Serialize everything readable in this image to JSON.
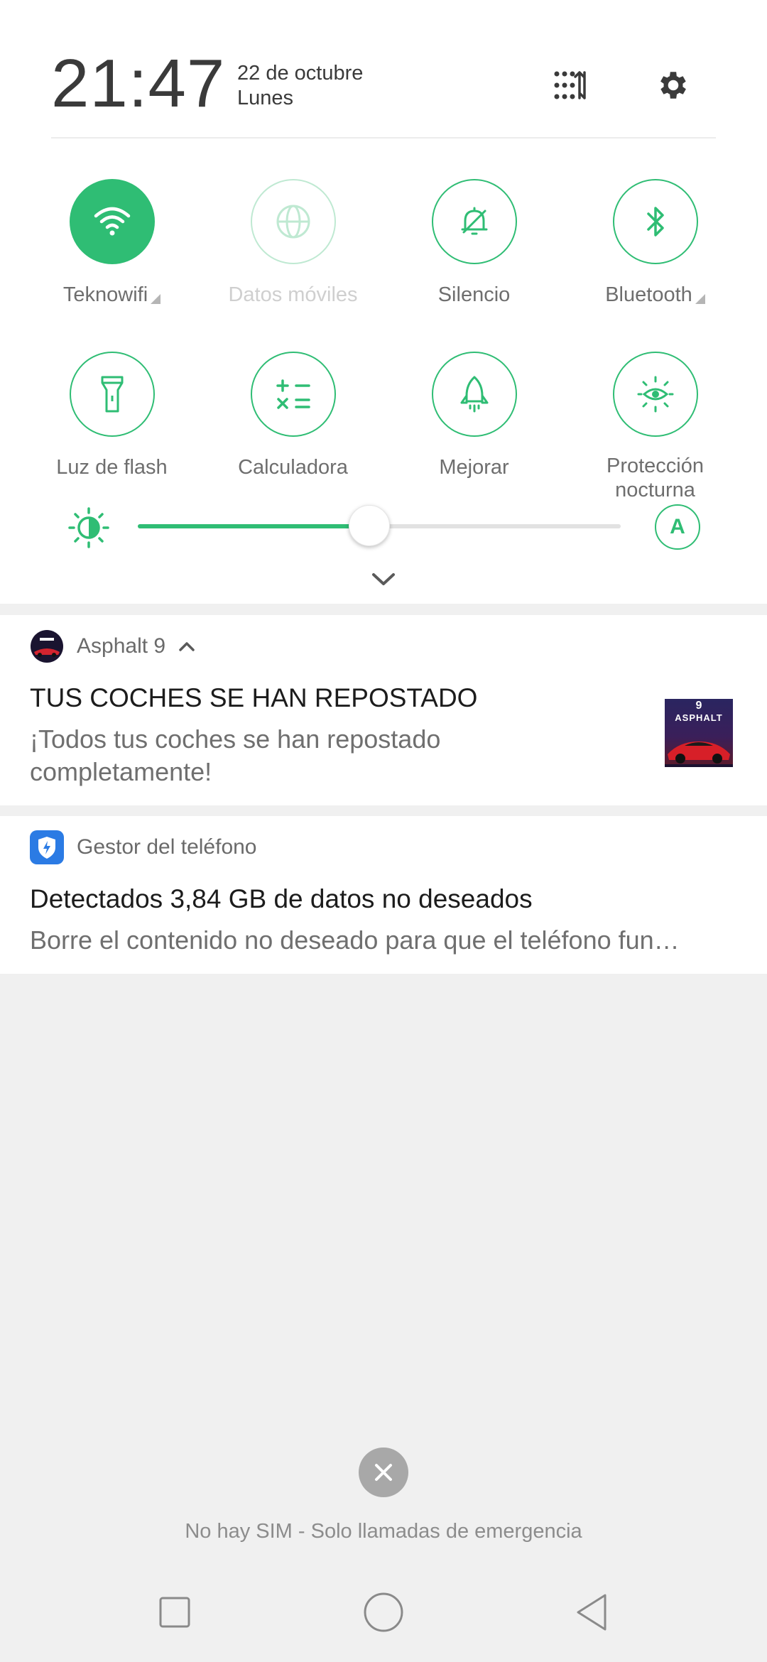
{
  "header": {
    "time": "21:47",
    "date": "22 de octubre",
    "weekday": "Lunes",
    "edit_icon": "grid-sort-icon",
    "settings_icon": "gear-icon"
  },
  "toggles": [
    {
      "label": "Teknowifi",
      "icon": "wifi-icon",
      "state": "on",
      "has_menu": true
    },
    {
      "label": "Datos móviles",
      "icon": "globe-icon",
      "state": "disabled",
      "has_menu": false
    },
    {
      "label": "Silencio",
      "icon": "bell-off-icon",
      "state": "off",
      "has_menu": false
    },
    {
      "label": "Bluetooth",
      "icon": "bluetooth-icon",
      "state": "off",
      "has_menu": true
    },
    {
      "label": "Luz de flash",
      "icon": "flashlight-icon",
      "state": "off"
    },
    {
      "label": "Calculadora",
      "icon": "calculator-icon",
      "state": "off"
    },
    {
      "label": "Mejorar",
      "icon": "rocket-icon",
      "state": "off"
    },
    {
      "label_line1": "Protección",
      "label_line2": "nocturna",
      "icon": "eye-sun-icon",
      "state": "off"
    }
  ],
  "brightness": {
    "level": 0.48,
    "auto_label": "A"
  },
  "notifications": [
    {
      "app": "Asphalt 9",
      "title": "TUS COCHES SE HAN REPOSTADO",
      "body_line1": "¡Todos tus coches se han repostado",
      "body_line2": "completamente!",
      "thumb_text_top": "9",
      "thumb_text": "ASPHALT"
    },
    {
      "app": "Gestor del teléfono",
      "title": "Detectados 3,84 GB de datos no deseados",
      "body": "Borre el contenido no deseado para que el teléfono fun…"
    }
  ],
  "lockscreen": {
    "sim_status": "No hay SIM - Solo llamadas de emergencia"
  },
  "colors": {
    "accent": "#2fbd74",
    "panel_bg": "#ffffff",
    "page_bg": "#f0f0f0"
  }
}
